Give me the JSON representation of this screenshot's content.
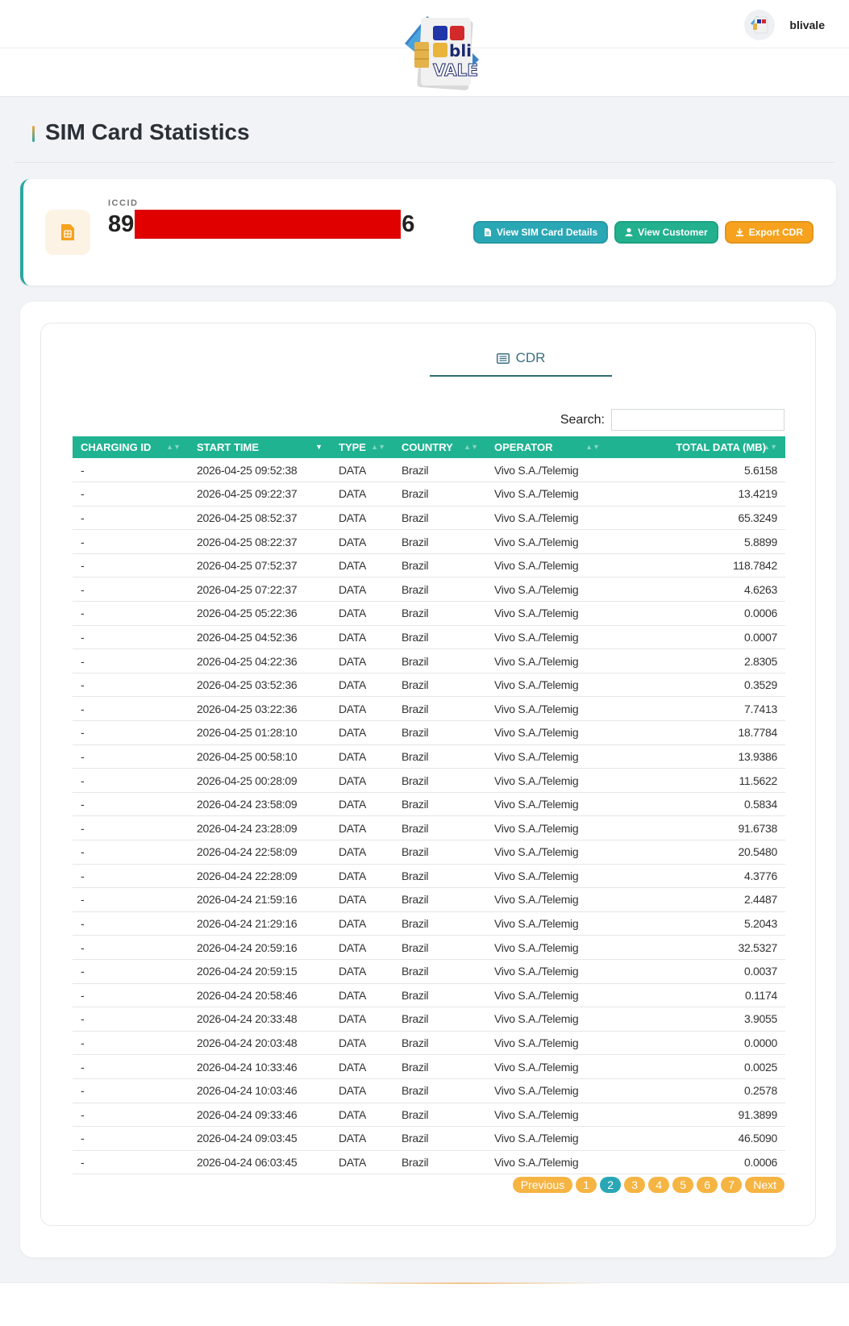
{
  "header": {
    "username": "blivale",
    "logo_text_top": "bli",
    "logo_text_bottom": "VALE"
  },
  "page": {
    "title": "SIM Card Statistics"
  },
  "iccid": {
    "label": "ICCID",
    "prefix": "89",
    "suffix": "6"
  },
  "actions": {
    "view_sim": "View SIM Card Details",
    "view_customer": "View Customer",
    "export_cdr": "Export CDR"
  },
  "tabs": {
    "cdr": "CDR"
  },
  "search": {
    "label": "Search:",
    "value": ""
  },
  "table": {
    "columns": [
      "CHARGING ID",
      "START TIME",
      "TYPE",
      "COUNTRY",
      "OPERATOR",
      "TOTAL DATA (MB)"
    ],
    "rows": [
      [
        "-",
        "2026-04-25 09:52:38",
        "DATA",
        "Brazil",
        "Vivo S.A./Telemig",
        "5.6158"
      ],
      [
        "-",
        "2026-04-25 09:22:37",
        "DATA",
        "Brazil",
        "Vivo S.A./Telemig",
        "13.4219"
      ],
      [
        "-",
        "2026-04-25 08:52:37",
        "DATA",
        "Brazil",
        "Vivo S.A./Telemig",
        "65.3249"
      ],
      [
        "-",
        "2026-04-25 08:22:37",
        "DATA",
        "Brazil",
        "Vivo S.A./Telemig",
        "5.8899"
      ],
      [
        "-",
        "2026-04-25 07:52:37",
        "DATA",
        "Brazil",
        "Vivo S.A./Telemig",
        "118.7842"
      ],
      [
        "-",
        "2026-04-25 07:22:37",
        "DATA",
        "Brazil",
        "Vivo S.A./Telemig",
        "4.6263"
      ],
      [
        "-",
        "2026-04-25 05:22:36",
        "DATA",
        "Brazil",
        "Vivo S.A./Telemig",
        "0.0006"
      ],
      [
        "-",
        "2026-04-25 04:52:36",
        "DATA",
        "Brazil",
        "Vivo S.A./Telemig",
        "0.0007"
      ],
      [
        "-",
        "2026-04-25 04:22:36",
        "DATA",
        "Brazil",
        "Vivo S.A./Telemig",
        "2.8305"
      ],
      [
        "-",
        "2026-04-25 03:52:36",
        "DATA",
        "Brazil",
        "Vivo S.A./Telemig",
        "0.3529"
      ],
      [
        "-",
        "2026-04-25 03:22:36",
        "DATA",
        "Brazil",
        "Vivo S.A./Telemig",
        "7.7413"
      ],
      [
        "-",
        "2026-04-25 01:28:10",
        "DATA",
        "Brazil",
        "Vivo S.A./Telemig",
        "18.7784"
      ],
      [
        "-",
        "2026-04-25 00:58:10",
        "DATA",
        "Brazil",
        "Vivo S.A./Telemig",
        "13.9386"
      ],
      [
        "-",
        "2026-04-25 00:28:09",
        "DATA",
        "Brazil",
        "Vivo S.A./Telemig",
        "11.5622"
      ],
      [
        "-",
        "2026-04-24 23:58:09",
        "DATA",
        "Brazil",
        "Vivo S.A./Telemig",
        "0.5834"
      ],
      [
        "-",
        "2026-04-24 23:28:09",
        "DATA",
        "Brazil",
        "Vivo S.A./Telemig",
        "91.6738"
      ],
      [
        "-",
        "2026-04-24 22:58:09",
        "DATA",
        "Brazil",
        "Vivo S.A./Telemig",
        "20.5480"
      ],
      [
        "-",
        "2026-04-24 22:28:09",
        "DATA",
        "Brazil",
        "Vivo S.A./Telemig",
        "4.3776"
      ],
      [
        "-",
        "2026-04-24 21:59:16",
        "DATA",
        "Brazil",
        "Vivo S.A./Telemig",
        "2.4487"
      ],
      [
        "-",
        "2026-04-24 21:29:16",
        "DATA",
        "Brazil",
        "Vivo S.A./Telemig",
        "5.2043"
      ],
      [
        "-",
        "2026-04-24 20:59:16",
        "DATA",
        "Brazil",
        "Vivo S.A./Telemig",
        "32.5327"
      ],
      [
        "-",
        "2026-04-24 20:59:15",
        "DATA",
        "Brazil",
        "Vivo S.A./Telemig",
        "0.0037"
      ],
      [
        "-",
        "2026-04-24 20:58:46",
        "DATA",
        "Brazil",
        "Vivo S.A./Telemig",
        "0.1174"
      ],
      [
        "-",
        "2026-04-24 20:33:48",
        "DATA",
        "Brazil",
        "Vivo S.A./Telemig",
        "3.9055"
      ],
      [
        "-",
        "2026-04-24 20:03:48",
        "DATA",
        "Brazil",
        "Vivo S.A./Telemig",
        "0.0000"
      ],
      [
        "-",
        "2026-04-24 10:33:46",
        "DATA",
        "Brazil",
        "Vivo S.A./Telemig",
        "0.0025"
      ],
      [
        "-",
        "2026-04-24 10:03:46",
        "DATA",
        "Brazil",
        "Vivo S.A./Telemig",
        "0.2578"
      ],
      [
        "-",
        "2026-04-24 09:33:46",
        "DATA",
        "Brazil",
        "Vivo S.A./Telemig",
        "91.3899"
      ],
      [
        "-",
        "2026-04-24 09:03:45",
        "DATA",
        "Brazil",
        "Vivo S.A./Telemig",
        "46.5090"
      ],
      [
        "-",
        "2026-04-24 06:03:45",
        "DATA",
        "Brazil",
        "Vivo S.A./Telemig",
        "0.0006"
      ]
    ]
  },
  "pagination": {
    "previous": "Previous",
    "next": "Next",
    "pages": [
      "1",
      "2",
      "3",
      "4",
      "5",
      "6",
      "7"
    ],
    "current": "2"
  },
  "colors": {
    "table_header": "#1fb391",
    "accent_teal": "#2aa7b4",
    "accent_orange": "#f6a21e",
    "redaction": "#e00000"
  }
}
